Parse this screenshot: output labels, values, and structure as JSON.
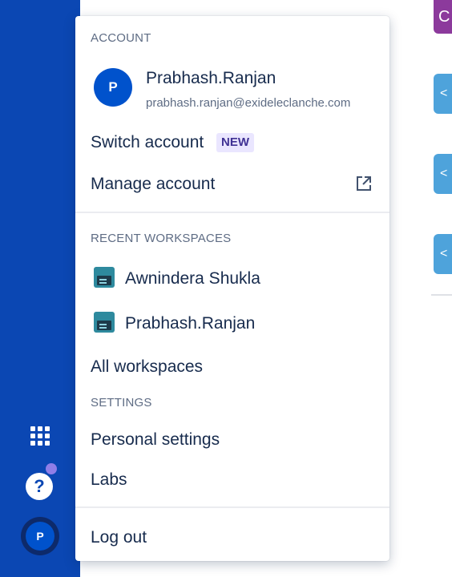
{
  "account_section": {
    "heading": "ACCOUNT",
    "avatar_initial": "P",
    "name": "Prabhash.Ranjan",
    "email": "prabhash.ranjan@exideleclanche.com",
    "switch_account": "Switch account",
    "new_badge": "NEW",
    "manage_account": "Manage account"
  },
  "recent_workspaces": {
    "heading": "RECENT WORKSPACES",
    "items": [
      {
        "name": "Awnindera Shukla"
      },
      {
        "name": "Prabhash.Ranjan"
      }
    ],
    "all_workspaces": "All workspaces"
  },
  "settings_section": {
    "heading": "SETTINGS",
    "personal_settings": "Personal settings",
    "labs": "Labs"
  },
  "logout": "Log out",
  "left_nav": {
    "help_glyph": "?",
    "avatar_initial": "P"
  },
  "colors": {
    "nav_blue": "#0b47b3",
    "avatar_blue": "#0052cc",
    "badge_bg": "#eae6ff",
    "badge_text": "#403294",
    "notification_dot": "#8f7ee7"
  },
  "icons": {
    "app_switcher": "grid-icon",
    "help": "help-icon",
    "external_link": "external-link-icon",
    "workspace": "workspace-icon"
  }
}
